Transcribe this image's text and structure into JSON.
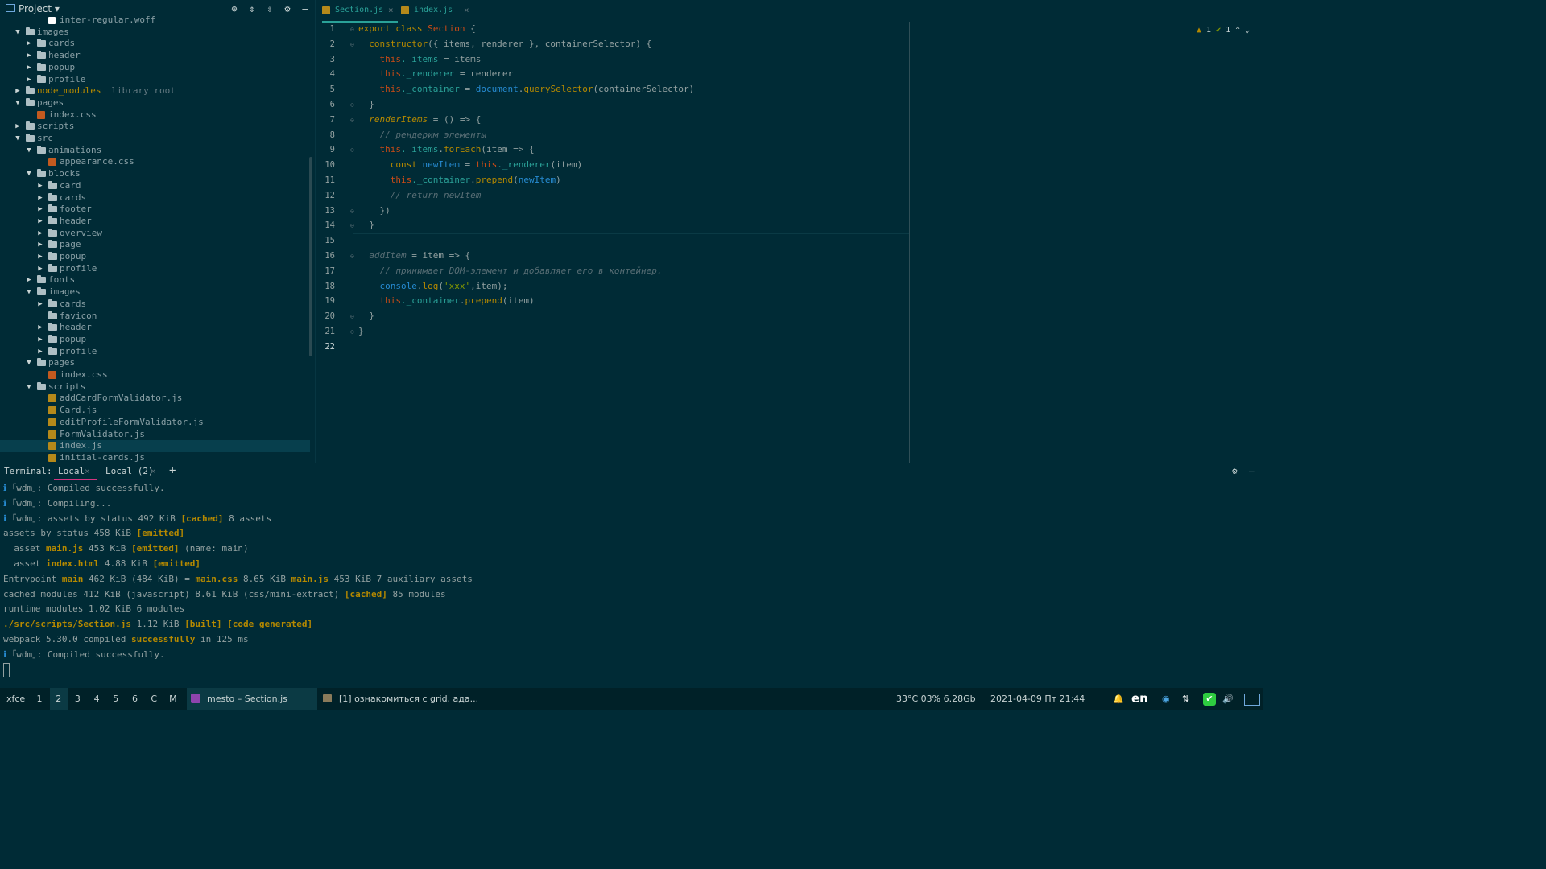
{
  "project": {
    "title": "Project",
    "tree": [
      {
        "label": "inter-regular.woff",
        "indent": 3,
        "kind": "plain",
        "arrow": ""
      },
      {
        "label": "images",
        "indent": 1,
        "kind": "folder",
        "arrow": "open"
      },
      {
        "label": "cards",
        "indent": 2,
        "kind": "folder",
        "arrow": "closed"
      },
      {
        "label": "header",
        "indent": 2,
        "kind": "folder",
        "arrow": "closed"
      },
      {
        "label": "popup",
        "indent": 2,
        "kind": "folder",
        "arrow": "closed"
      },
      {
        "label": "profile",
        "indent": 2,
        "kind": "folder",
        "arrow": "closed"
      },
      {
        "label": "node_modules",
        "indent": 1,
        "kind": "folder",
        "arrow": "closed",
        "lib": true,
        "hint": "library root"
      },
      {
        "label": "pages",
        "indent": 1,
        "kind": "folder",
        "arrow": "open"
      },
      {
        "label": "index.css",
        "indent": 2,
        "kind": "file",
        "arrow": ""
      },
      {
        "label": "scripts",
        "indent": 1,
        "kind": "folder",
        "arrow": "closed"
      },
      {
        "label": "src",
        "indent": 1,
        "kind": "folder",
        "arrow": "open"
      },
      {
        "label": "animations",
        "indent": 2,
        "kind": "folder",
        "arrow": "open"
      },
      {
        "label": "appearance.css",
        "indent": 3,
        "kind": "file",
        "arrow": ""
      },
      {
        "label": "blocks",
        "indent": 2,
        "kind": "folder",
        "arrow": "open"
      },
      {
        "label": "card",
        "indent": 3,
        "kind": "folder",
        "arrow": "closed"
      },
      {
        "label": "cards",
        "indent": 3,
        "kind": "folder",
        "arrow": "closed"
      },
      {
        "label": "footer",
        "indent": 3,
        "kind": "folder",
        "arrow": "closed"
      },
      {
        "label": "header",
        "indent": 3,
        "kind": "folder",
        "arrow": "closed"
      },
      {
        "label": "overview",
        "indent": 3,
        "kind": "folder",
        "arrow": "closed"
      },
      {
        "label": "page",
        "indent": 3,
        "kind": "folder",
        "arrow": "closed"
      },
      {
        "label": "popup",
        "indent": 3,
        "kind": "folder",
        "arrow": "closed"
      },
      {
        "label": "profile",
        "indent": 3,
        "kind": "folder",
        "arrow": "closed"
      },
      {
        "label": "fonts",
        "indent": 2,
        "kind": "folder",
        "arrow": "closed"
      },
      {
        "label": "images",
        "indent": 2,
        "kind": "folder",
        "arrow": "open"
      },
      {
        "label": "cards",
        "indent": 3,
        "kind": "folder",
        "arrow": "closed"
      },
      {
        "label": "favicon",
        "indent": 3,
        "kind": "folder",
        "arrow": ""
      },
      {
        "label": "header",
        "indent": 3,
        "kind": "folder",
        "arrow": "closed"
      },
      {
        "label": "popup",
        "indent": 3,
        "kind": "folder",
        "arrow": "closed"
      },
      {
        "label": "profile",
        "indent": 3,
        "kind": "folder",
        "arrow": "closed"
      },
      {
        "label": "pages",
        "indent": 2,
        "kind": "folder",
        "arrow": "open"
      },
      {
        "label": "index.css",
        "indent": 3,
        "kind": "file",
        "arrow": ""
      },
      {
        "label": "scripts",
        "indent": 2,
        "kind": "folder",
        "arrow": "open"
      },
      {
        "label": "addCardFormValidator.js",
        "indent": 3,
        "kind": "js",
        "arrow": ""
      },
      {
        "label": "Card.js",
        "indent": 3,
        "kind": "js",
        "arrow": ""
      },
      {
        "label": "editProfileFormValidator.js",
        "indent": 3,
        "kind": "js",
        "arrow": ""
      },
      {
        "label": "FormValidator.js",
        "indent": 3,
        "kind": "js",
        "arrow": ""
      },
      {
        "label": "index.js",
        "indent": 3,
        "kind": "js",
        "arrow": "",
        "selected": true
      },
      {
        "label": "initial-cards.js",
        "indent": 3,
        "kind": "js",
        "arrow": ""
      }
    ]
  },
  "tabs": [
    {
      "label": "Section.js",
      "active": true
    },
    {
      "label": "index.js",
      "active": false
    }
  ],
  "inspections": {
    "warnings": "1",
    "ok": "1"
  },
  "code": {
    "line_numbers": [
      "1",
      "2",
      "3",
      "4",
      "5",
      "6",
      "7",
      "8",
      "9",
      "10",
      "11",
      "12",
      "13",
      "14",
      "15",
      "16",
      "17",
      "18",
      "19",
      "20",
      "21",
      "22"
    ],
    "lines": [
      [
        [
          "k",
          "export "
        ],
        [
          "k",
          "class "
        ],
        [
          "c",
          "Section"
        ],
        [
          "plain",
          " {"
        ]
      ],
      [
        [
          "k",
          "  constructor"
        ],
        [
          "plain",
          "({ items, renderer }, containerSelector) {"
        ]
      ],
      [
        [
          "plain",
          "    "
        ],
        [
          "c",
          "this"
        ],
        [
          "pr",
          "._items"
        ],
        [
          "plain",
          " = items"
        ]
      ],
      [
        [
          "plain",
          "    "
        ],
        [
          "c",
          "this"
        ],
        [
          "pr",
          "._renderer"
        ],
        [
          "plain",
          " = renderer"
        ]
      ],
      [
        [
          "plain",
          "    "
        ],
        [
          "c",
          "this"
        ],
        [
          "pr",
          "._container"
        ],
        [
          "plain",
          " = "
        ],
        [
          "f",
          "document"
        ],
        [
          "plain",
          "."
        ],
        [
          "k",
          "querySelector"
        ],
        [
          "plain",
          "(containerSelector)"
        ]
      ],
      [
        [
          "plain",
          "  }"
        ]
      ],
      [
        [
          "plain",
          "  "
        ],
        [
          "fn-decl",
          "renderItems"
        ],
        [
          "plain",
          " = () => {"
        ]
      ],
      [
        [
          "plain",
          "    "
        ],
        [
          "cm",
          "// рендерим элементы"
        ]
      ],
      [
        [
          "plain",
          "    "
        ],
        [
          "c",
          "this"
        ],
        [
          "pr",
          "._items"
        ],
        [
          "plain",
          "."
        ],
        [
          "k",
          "forEach"
        ],
        [
          "plain",
          "(item => {"
        ]
      ],
      [
        [
          "plain",
          "      "
        ],
        [
          "k",
          "const "
        ],
        [
          "f",
          "newItem"
        ],
        [
          "plain",
          " = "
        ],
        [
          "c",
          "this"
        ],
        [
          "pr",
          "._renderer"
        ],
        [
          "plain",
          "(item)"
        ]
      ],
      [
        [
          "plain",
          "      "
        ],
        [
          "c",
          "this"
        ],
        [
          "pr",
          "._container"
        ],
        [
          "plain",
          "."
        ],
        [
          "k",
          "prepend"
        ],
        [
          "plain",
          "("
        ],
        [
          "f",
          "newItem"
        ],
        [
          "plain",
          ")"
        ]
      ],
      [
        [
          "plain",
          "      "
        ],
        [
          "cm",
          "// return newItem"
        ]
      ],
      [
        [
          "plain",
          "    })"
        ]
      ],
      [
        [
          "plain",
          "  }"
        ]
      ],
      [
        [
          "plain",
          ""
        ]
      ],
      [
        [
          "plain",
          "  "
        ],
        [
          "cm",
          "addItem"
        ],
        [
          "plain",
          " = item => {"
        ]
      ],
      [
        [
          "plain",
          "    "
        ],
        [
          "cm",
          "// принимает DOM-элемент и добавляет его в контейнер."
        ]
      ],
      [
        [
          "plain",
          "    "
        ],
        [
          "f",
          "console"
        ],
        [
          "plain",
          "."
        ],
        [
          "k",
          "log"
        ],
        [
          "plain",
          "("
        ],
        [
          "st",
          "'xxx'"
        ],
        [
          "plain",
          ",item);"
        ]
      ],
      [
        [
          "plain",
          "    "
        ],
        [
          "c",
          "this"
        ],
        [
          "pr",
          "._container"
        ],
        [
          "plain",
          "."
        ],
        [
          "k",
          "prepend"
        ],
        [
          "plain",
          "(item)"
        ]
      ],
      [
        [
          "plain",
          "  }"
        ]
      ],
      [
        [
          "plain",
          "}"
        ]
      ],
      [
        [
          "plain",
          ""
        ]
      ]
    ]
  },
  "terminal": {
    "label": "Terminal:",
    "tabs": [
      {
        "label": "Local",
        "active": true
      },
      {
        "label": "Local (2)",
        "active": false
      }
    ],
    "add": "+",
    "lines": [
      [
        [
          "ti",
          "ℹ "
        ],
        [
          "plain",
          "｢wdm｣: Compiled successfully."
        ]
      ],
      [
        [
          "ti",
          "ℹ "
        ],
        [
          "plain",
          "｢wdm｣: Compiling..."
        ]
      ],
      [
        [
          "ti",
          "ℹ "
        ],
        [
          "plain",
          "｢wdm｣: assets by status 492 KiB "
        ],
        [
          "tb",
          "[cached]"
        ],
        [
          "plain",
          " 8 assets"
        ]
      ],
      [
        [
          "plain",
          "assets by status 458 KiB "
        ],
        [
          "tb",
          "[emitted]"
        ]
      ],
      [
        [
          "plain",
          "  asset "
        ],
        [
          "tb",
          "main.js"
        ],
        [
          "plain",
          " 453 KiB "
        ],
        [
          "tb",
          "[emitted]"
        ],
        [
          "plain",
          " (name: main)"
        ]
      ],
      [
        [
          "plain",
          "  asset "
        ],
        [
          "tb",
          "index.html"
        ],
        [
          "plain",
          " 4.88 KiB "
        ],
        [
          "tb",
          "[emitted]"
        ]
      ],
      [
        [
          "plain",
          "Entrypoint "
        ],
        [
          "tb",
          "main"
        ],
        [
          "plain",
          " 462 KiB (484 KiB) = "
        ],
        [
          "tb",
          "main.css"
        ],
        [
          "plain",
          " 8.65 KiB "
        ],
        [
          "tb",
          "main.js"
        ],
        [
          "plain",
          " 453 KiB 7 auxiliary assets"
        ]
      ],
      [
        [
          "plain",
          "cached modules 412 KiB (javascript) 8.61 KiB (css/mini-extract) "
        ],
        [
          "tb",
          "[cached]"
        ],
        [
          "plain",
          " 85 modules"
        ]
      ],
      [
        [
          "plain",
          "runtime modules 1.02 KiB 6 modules"
        ]
      ],
      [
        [
          "tb",
          "./src/scripts/Section.js"
        ],
        [
          "plain",
          " 1.12 KiB "
        ],
        [
          "tb",
          "[built] [code generated]"
        ]
      ],
      [
        [
          "plain",
          "webpack 5.30.0 compiled "
        ],
        [
          "tb",
          "successfully"
        ],
        [
          "plain",
          " in 125 ms"
        ]
      ],
      [
        [
          "ti",
          "ℹ "
        ],
        [
          "plain",
          "｢wdm｣: Compiled successfully."
        ]
      ]
    ]
  },
  "taskbar": {
    "menu": "xfce",
    "workspaces": [
      "1",
      "2",
      "3",
      "4",
      "5",
      "6",
      "C",
      "M"
    ],
    "active_workspace": "2",
    "windows": [
      {
        "label": "mesto – Section.js",
        "active": true
      },
      {
        "label": "[1] ознакомиться с grid, ада...",
        "active": false
      }
    ],
    "status": "33°C 03% 6.28Gb",
    "datetime": "2021-04-09 Пт 21:44",
    "lang": "en"
  },
  "colors": {
    "bg": "#002b36",
    "accent": "#2aa198",
    "keyword": "#b58900",
    "this": "#cb4b16",
    "member": "#268bd2",
    "comment": "#586e75",
    "active_tab": "#d33682"
  }
}
